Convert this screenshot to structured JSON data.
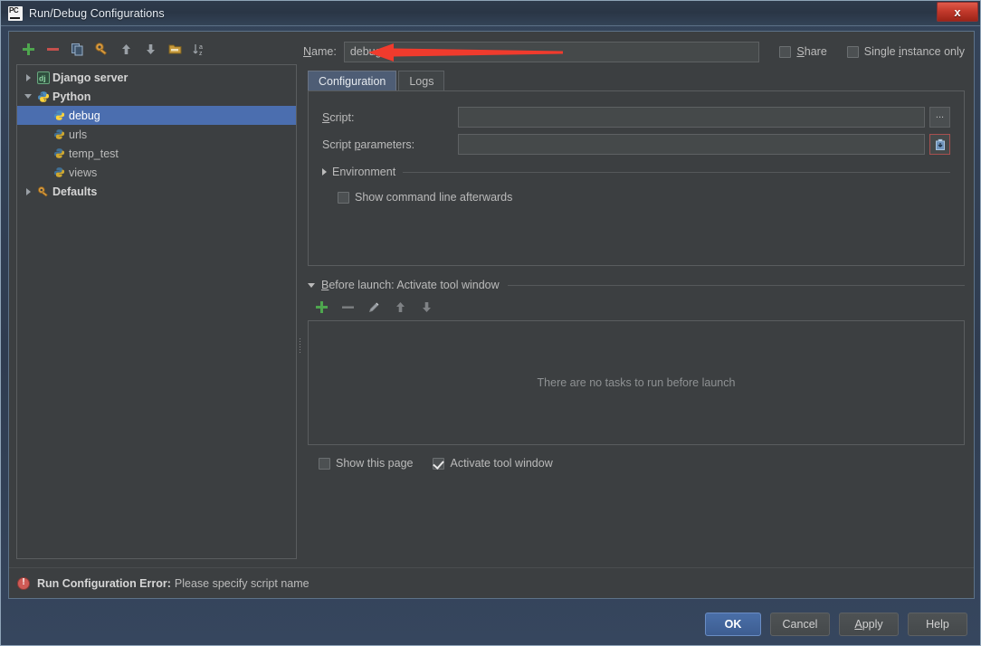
{
  "window": {
    "title": "Run/Debug Configurations",
    "app_icon": "pycharm-icon",
    "close_label": "x"
  },
  "tree_toolbar": {
    "icons": [
      {
        "name": "add-configuration-icon",
        "label": "+"
      },
      {
        "name": "remove-configuration-icon",
        "label": "−"
      },
      {
        "name": "copy-configuration-icon",
        "label": "copy"
      },
      {
        "name": "edit-defaults-icon",
        "label": "wrench"
      },
      {
        "name": "move-up-icon",
        "label": "up"
      },
      {
        "name": "move-down-icon",
        "label": "down"
      },
      {
        "name": "move-into-folder-icon",
        "label": "folder"
      },
      {
        "name": "sort-alphabetically-icon",
        "label": "sort a-z"
      }
    ]
  },
  "tree": {
    "nodes": [
      {
        "label": "Django server",
        "icon": "django-icon",
        "level": 0,
        "expander": "right",
        "type": "group",
        "selected": false
      },
      {
        "label": "Python",
        "icon": "python-icon",
        "level": 0,
        "expander": "down",
        "type": "group",
        "selected": false
      },
      {
        "label": "debug",
        "icon": "python-file-icon",
        "level": 1,
        "expander": "none",
        "type": "item",
        "selected": true
      },
      {
        "label": "urls",
        "icon": "python-file-icon",
        "level": 1,
        "expander": "none",
        "type": "item",
        "selected": false
      },
      {
        "label": "temp_test",
        "icon": "python-file-icon",
        "level": 1,
        "expander": "none",
        "type": "item",
        "selected": false
      },
      {
        "label": "views",
        "icon": "python-file-icon",
        "level": 1,
        "expander": "none",
        "type": "item",
        "selected": false
      },
      {
        "label": "Defaults",
        "icon": "defaults-wrench-icon",
        "level": 0,
        "expander": "right",
        "type": "group",
        "selected": false
      }
    ]
  },
  "name_row": {
    "label": "Name:",
    "label_mnemonic": "N",
    "value": "debug",
    "placeholder": "",
    "share": {
      "label": "Share",
      "mnemonic": "S",
      "checked": false
    },
    "single_instance": {
      "label": "Single instance only",
      "mnemonic": "i",
      "checked": false
    }
  },
  "annotation": {
    "type": "red-arrow",
    "color": "#f03b2d",
    "points_to": "name-input"
  },
  "tabs": [
    {
      "label": "Configuration",
      "active": true
    },
    {
      "label": "Logs",
      "active": false
    }
  ],
  "configuration": {
    "script": {
      "label": "Script:",
      "mnemonic": "S",
      "value": "",
      "placeholder": "",
      "browse_label": "..."
    },
    "script_parameters": {
      "label": "Script parameters:",
      "mnemonic": "p",
      "value": "",
      "placeholder": "",
      "expand_icon": "expand-macro-icon"
    },
    "environment": {
      "label": "Environment",
      "expanded": false
    },
    "show_command_line": {
      "label": "Show command line afterwards",
      "checked": false
    }
  },
  "before_launch": {
    "header": "Before launch: Activate tool window",
    "header_mnemonic": "B",
    "expanded": true,
    "toolbar": [
      {
        "name": "add-task-icon",
        "label": "+"
      },
      {
        "name": "remove-task-icon",
        "label": "−"
      },
      {
        "name": "edit-task-icon",
        "label": "pencil"
      },
      {
        "name": "move-task-up-icon",
        "label": "up"
      },
      {
        "name": "move-task-down-icon",
        "label": "down"
      }
    ],
    "empty_text": "There are no tasks to run before launch",
    "show_this_page": {
      "label": "Show this page",
      "checked": false
    },
    "activate_tool_window": {
      "label": "Activate tool window",
      "checked": true
    }
  },
  "error": {
    "title": "Run Configuration Error:",
    "message": "Please specify script name"
  },
  "buttons": [
    {
      "label": "OK",
      "primary": true,
      "mnemonic": ""
    },
    {
      "label": "Cancel",
      "primary": false,
      "mnemonic": ""
    },
    {
      "label": "Apply",
      "primary": false,
      "mnemonic": "A"
    },
    {
      "label": "Help",
      "primary": false,
      "mnemonic": ""
    }
  ],
  "colors": {
    "background": "#3c3f41",
    "selection": "#4b6eaf",
    "title_bar": "#2f3c50",
    "error": "#cf5b56",
    "accent_green": "#4e9a4e",
    "accent_red": "#c0504d",
    "annotation_red": "#f03b2d"
  }
}
